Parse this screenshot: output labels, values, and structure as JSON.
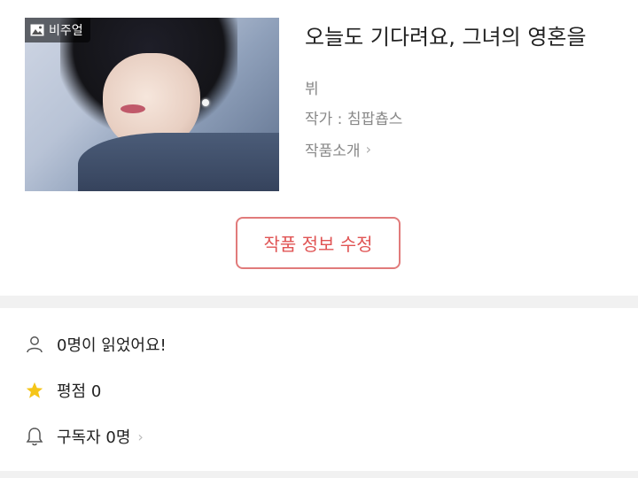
{
  "cover": {
    "badge_label": "비주얼"
  },
  "work": {
    "title": "오늘도 기다려요, 그녀의 영혼을",
    "tag": "뷔",
    "author": "작가 : 침팝춉스",
    "intro_label": "작품소개"
  },
  "actions": {
    "edit_label": "작품 정보 수정"
  },
  "stats": {
    "readers": "0명이 읽었어요!",
    "rating": "평점 0",
    "subscribers": "구독자 0명"
  },
  "colors": {
    "accent": "#e05454",
    "star": "#f5c518",
    "muted": "#888888"
  }
}
